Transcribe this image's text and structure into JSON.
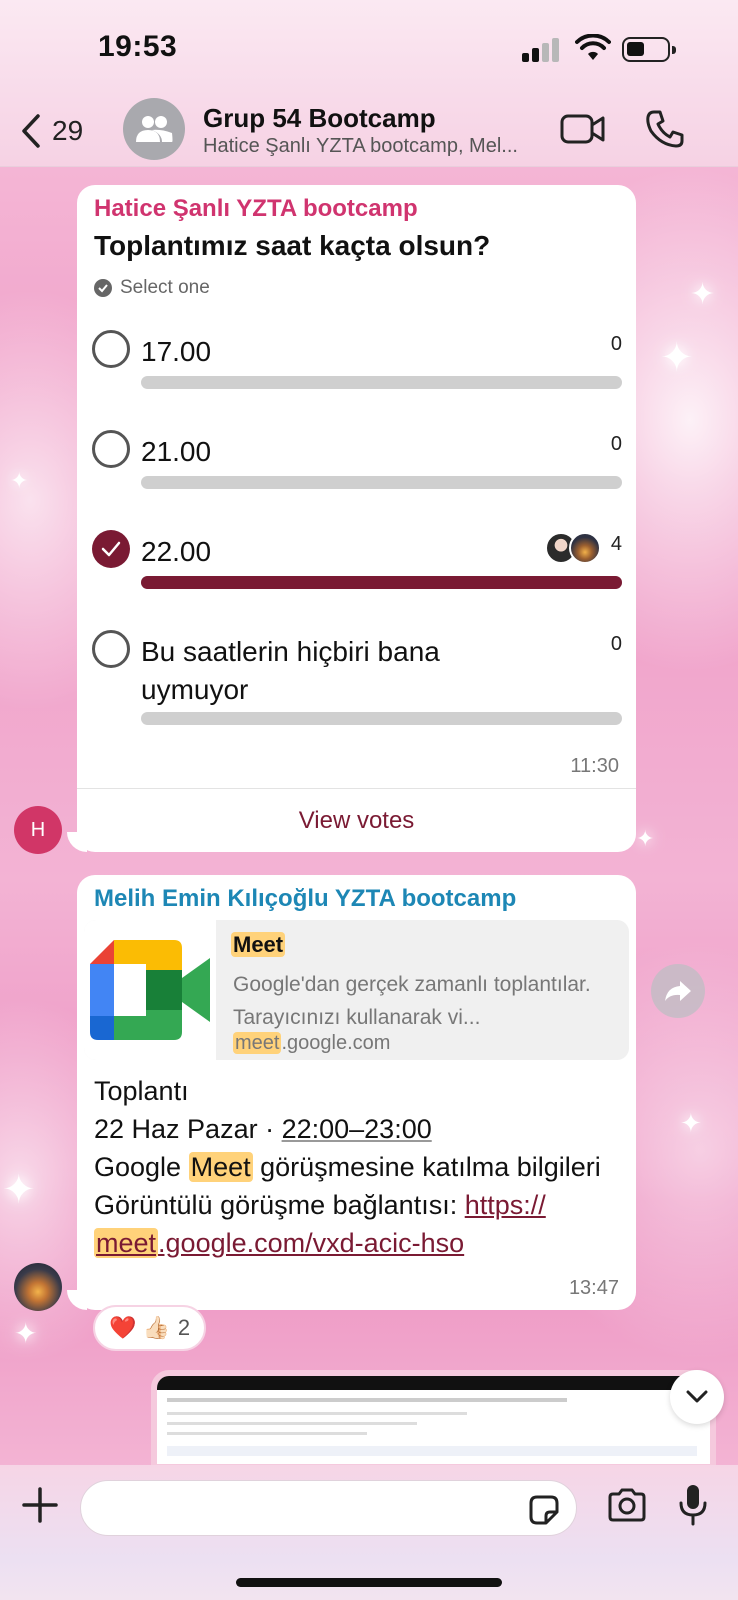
{
  "status": {
    "time": "19:53"
  },
  "header": {
    "back_count": "29",
    "title": "Grup 54 Bootcamp",
    "subtitle": "Hatice Şanlı YZTA bootcamp, Mel..."
  },
  "poll": {
    "sender": "Hatice Şanlı YZTA bootcamp",
    "question": "Toplantımız saat kaçta olsun?",
    "hint": "Select one",
    "options": [
      {
        "label": "17.00",
        "count": "0",
        "selected": false,
        "fill": 0
      },
      {
        "label": "21.00",
        "count": "0",
        "selected": false,
        "fill": 0
      },
      {
        "label": "22.00",
        "count": "4",
        "selected": true,
        "fill": 1
      },
      {
        "label": "Bu saatlerin hiçbiri bana uymuyor",
        "count": "0",
        "selected": false,
        "fill": 0
      }
    ],
    "time": "11:30",
    "view_votes": "View votes",
    "avatar_initial": "H"
  },
  "link_msg": {
    "sender": "Melih Emin Kılıçoğlu YZTA bootcamp",
    "preview_title": "Meet",
    "preview_desc": "Google'dan gerçek zamanlı toplantılar. Tarayıcınızı kullanarak vi...",
    "preview_url_hl": "meet",
    "preview_url_rest": ".google.com",
    "line1": "Toplantı",
    "line2_prefix": "22 Haz Pazar · ",
    "line2_time": "22:00–23:00",
    "line3_prefix": "Google ",
    "line3_hl": "Meet",
    "line3_rest": " görüşmesine katılma bilgileri",
    "line4_prefix": "Görüntülü görüşme bağlantısı: ",
    "link_part1": "https://",
    "link_part2_hl": "meet",
    "link_part2_rest": ".google.com/vxd-acic-hso",
    "time": "13:47"
  },
  "reactions": {
    "emojis": "❤️ 👍🏻",
    "count": "2"
  },
  "input": {
    "placeholder": ""
  },
  "colors": {
    "accent": "#7a1a33",
    "sender1": "#d0346f",
    "sender2": "#1d87b5",
    "highlight": "#ffd27a"
  }
}
